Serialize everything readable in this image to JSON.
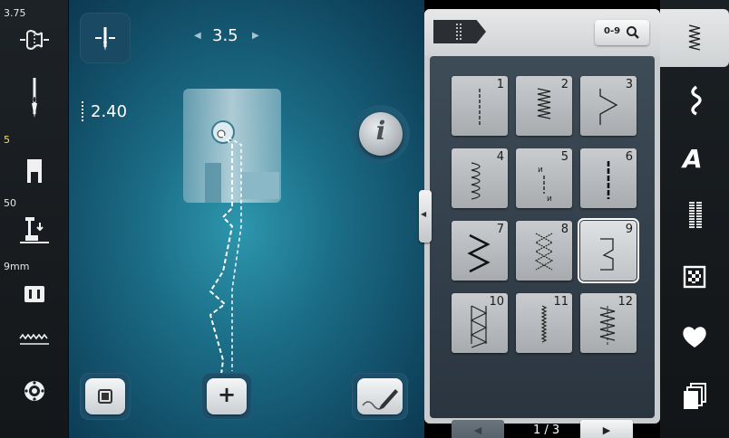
{
  "left_sidebar": {
    "items": [
      {
        "label": "3.75",
        "icon": "stitch-width-icon",
        "label_color": "#e6e6e6"
      },
      {
        "label": "",
        "icon": "needle-icon",
        "label_color": "#e6e6e6"
      },
      {
        "label": "5",
        "icon": "presser-foot-icon",
        "label_color": "#f3e34a"
      },
      {
        "label": "50",
        "icon": "presser-foot-pressure-icon",
        "label_color": "#e6e6e6"
      },
      {
        "label": "9mm",
        "icon": "stitch-plate-icon",
        "label_color": "#e6e6e6"
      },
      {
        "label": "",
        "icon": "feed-dog-icon",
        "label_color": "#e6e6e6"
      },
      {
        "label": "",
        "icon": "bobbin-icon",
        "label_color": "#e6e6e6"
      }
    ]
  },
  "main": {
    "needle_position_value": "3.5",
    "stitch_length_value": "2.40",
    "info_button_label": "i",
    "add_button_label": "+"
  },
  "panel": {
    "search_label": "0-9",
    "page_indicator": "1 / 3",
    "stitches": [
      {
        "num": "1",
        "pattern": "straight"
      },
      {
        "num": "2",
        "pattern": "zigzag-dense"
      },
      {
        "num": "3",
        "pattern": "zigzag-wide"
      },
      {
        "num": "4",
        "pattern": "wave"
      },
      {
        "num": "5",
        "pattern": "reverse-straight"
      },
      {
        "num": "6",
        "pattern": "triple-straight"
      },
      {
        "num": "7",
        "pattern": "zigzag-bold"
      },
      {
        "num": "8",
        "pattern": "honeycomb"
      },
      {
        "num": "9",
        "pattern": "blind"
      },
      {
        "num": "10",
        "pattern": "overlock"
      },
      {
        "num": "11",
        "pattern": "satin"
      },
      {
        "num": "12",
        "pattern": "stretch-zigzag"
      }
    ],
    "selected": "9"
  },
  "right_sidebar": {
    "items": [
      {
        "icon": "practical-stitches-icon",
        "active": true
      },
      {
        "icon": "decorative-stitches-icon",
        "active": false
      },
      {
        "icon": "alphabets-icon",
        "active": false
      },
      {
        "icon": "buttonholes-icon",
        "active": false
      },
      {
        "icon": "quilt-stitches-icon",
        "active": false
      },
      {
        "icon": "favorites-icon",
        "active": false
      },
      {
        "icon": "combinations-icon",
        "active": false
      }
    ]
  },
  "colors": {
    "accent_yellow": "#f3e34a",
    "background_blue": "#1b6c86",
    "panel_grey": "#c9ccce"
  }
}
